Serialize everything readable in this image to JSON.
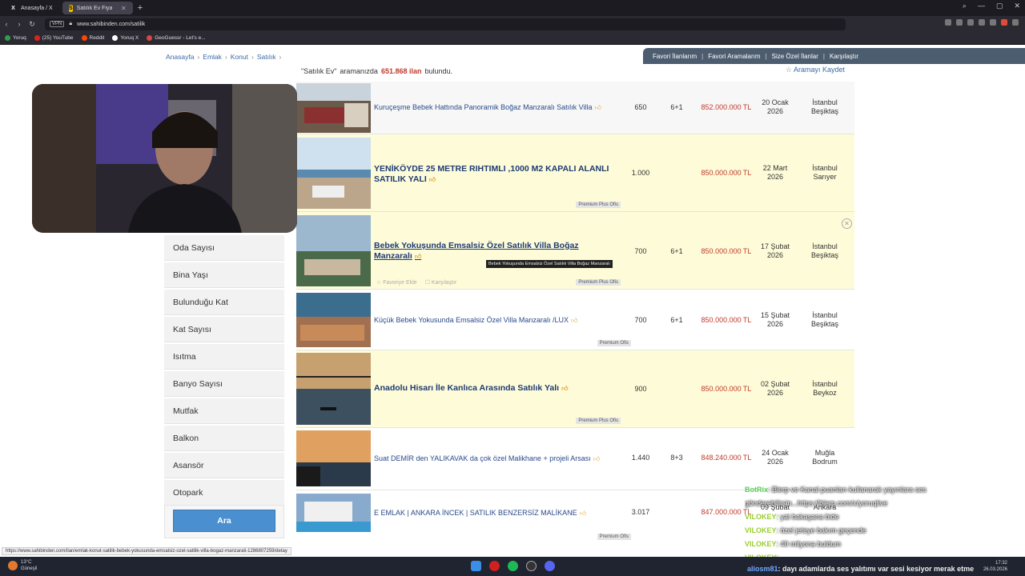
{
  "browser": {
    "tabs": [
      {
        "label": "Anasayfa / X",
        "active": false
      },
      {
        "label": "Satılık Ev Fiyatları sahibin",
        "active": true
      }
    ],
    "url": "www.sahibinden.com/satilik",
    "vpn_label": "VPN",
    "bookmarks": [
      "Yoruq",
      "(25) YouTube",
      "Reddit",
      "Yoruq X",
      "GeoGuessr - Let's e..."
    ]
  },
  "breadcrumb": [
    "Anasayfa",
    "Emlak",
    "Konut",
    "Satılık"
  ],
  "fav_nav": [
    "Favori İlanlarım",
    "Favori Aramalarım",
    "Size Özel İlanlar",
    "Karşılaştır"
  ],
  "results": {
    "query": "\"Satılık Ev\"",
    "pre": "aramanızda",
    "count": "651.868 ilan",
    "post": "bulundu.",
    "save_label": "Aramayı Kaydet"
  },
  "filters": [
    "Oda Sayısı",
    "Bina Yaşı",
    "Bulunduğu Kat",
    "Kat Sayısı",
    "Isıtma",
    "Banyo Sayısı",
    "Mutfak",
    "Balkon",
    "Asansör",
    "Otopark"
  ],
  "search_button": "Ara",
  "listings": [
    {
      "title": "Kuruçeşme Bebek Hattında Panoramik Boğaz Manzaralı Satılık Villa",
      "m2": "650",
      "rooms": "6+1",
      "price": "852.000.000 TL",
      "date1": "20 Ocak",
      "date2": "2026",
      "loc1": "İstanbul",
      "loc2": "Beşiktaş",
      "badge": "",
      "highlight": false
    },
    {
      "title": "YENİKÖYDE 25 METRE RIHTIMLI ,1000 M2 KAPALI ALANLI SATILIK YALI",
      "m2": "1.000",
      "rooms": "",
      "price": "850.000.000 TL",
      "date1": "22 Mart",
      "date2": "2026",
      "loc1": "İstanbul",
      "loc2": "Sarıyer",
      "badge": "Premium Plus Ofis",
      "highlight": true
    },
    {
      "title": "Bebek Yokuşunda Emsalsiz Özel Satılık Villa Boğaz Manzaralı",
      "m2": "700",
      "rooms": "6+1",
      "price": "850.000.000 TL",
      "date1": "17 Şubat",
      "date2": "2026",
      "loc1": "İstanbul",
      "loc2": "Beşiktaş",
      "badge": "Premium Plus Ofis",
      "highlight": true
    },
    {
      "title": "Küçük Bebek Yokusunda Emsalsiz Özel Villa Manzaralı /LUX",
      "m2": "700",
      "rooms": "6+1",
      "price": "850.000.000 TL",
      "date1": "15 Şubat",
      "date2": "2026",
      "loc1": "İstanbul",
      "loc2": "Beşiktaş",
      "badge": "Premium Ofis",
      "highlight": false
    },
    {
      "title": "Anadolu Hisarı İle Kanlıca Arasında Satılık Yalı",
      "m2": "900",
      "rooms": "",
      "price": "850.000.000 TL",
      "date1": "02 Şubat",
      "date2": "2026",
      "loc1": "İstanbul",
      "loc2": "Beykoz",
      "badge": "Premium Plus Ofis",
      "highlight": true
    },
    {
      "title": "Suat DEMİR den YALIKAVAK da çok özel Malikhane + projeli Arsası",
      "m2": "1.440",
      "rooms": "8+3",
      "price": "848.240.000 TL",
      "date1": "24 Ocak",
      "date2": "2026",
      "loc1": "Muğla",
      "loc2": "Bodrum",
      "badge": "",
      "highlight": false
    },
    {
      "title": "E EMLAK | ANKARA İNCEK | SATILIK BENZERSİZ MALİKANE",
      "m2": "3.017",
      "rooms": "",
      "price": "847.000.000 TL",
      "date1": "09 Şubat",
      "date2": "",
      "loc1": "Ankara",
      "loc2": "",
      "badge": "Premium Ofis",
      "highlight": false
    }
  ],
  "row_actions": {
    "favorite": "Favoriye Ekle",
    "compare": "Karşılaştır"
  },
  "tooltip": "Bebek Yokuşunda Emsalsiz Özel Satılık Villa Boğaz Manzaralı",
  "status_url": "https://www.sahibinden.com/ilan/emlak-konut-satilik-bebek-yokusunda-emsalsiz-ozel-satilik-villa-bogaz-manzarali-1286807259/detay",
  "chat": [
    {
      "user": "BotRix",
      "color": "#55cc55",
      "text": ": Blerp ve Kanal puanları kullanarak yayınlara ses"
    },
    {
      "user": "",
      "color": "#55cc55",
      "text": "gönderebilirsin...https://blerp.com/x/yoruqlive"
    },
    {
      "user": "VILOKEY",
      "color": "#9acd32",
      "text": ": yat bakaşana bide"
    },
    {
      "user": "VILOKEY",
      "color": "#9acd32",
      "text": ": özel jeteye bakım geçende"
    },
    {
      "user": "VILOKEY",
      "color": "#9acd32",
      "text": ": 40 milyona buldum"
    },
    {
      "user": "VILOKEY",
      "color": "#9acd32",
      "text": ":"
    }
  ],
  "bottom_chat": {
    "user": "aliosm81",
    "text": ": dayı adamlarda ses yalıtımı var sesi kesiyor merak etme"
  },
  "taskbar": {
    "temp": "13°C",
    "weather": "Güneşli",
    "time": "17:32",
    "date": "26.03.2026"
  }
}
